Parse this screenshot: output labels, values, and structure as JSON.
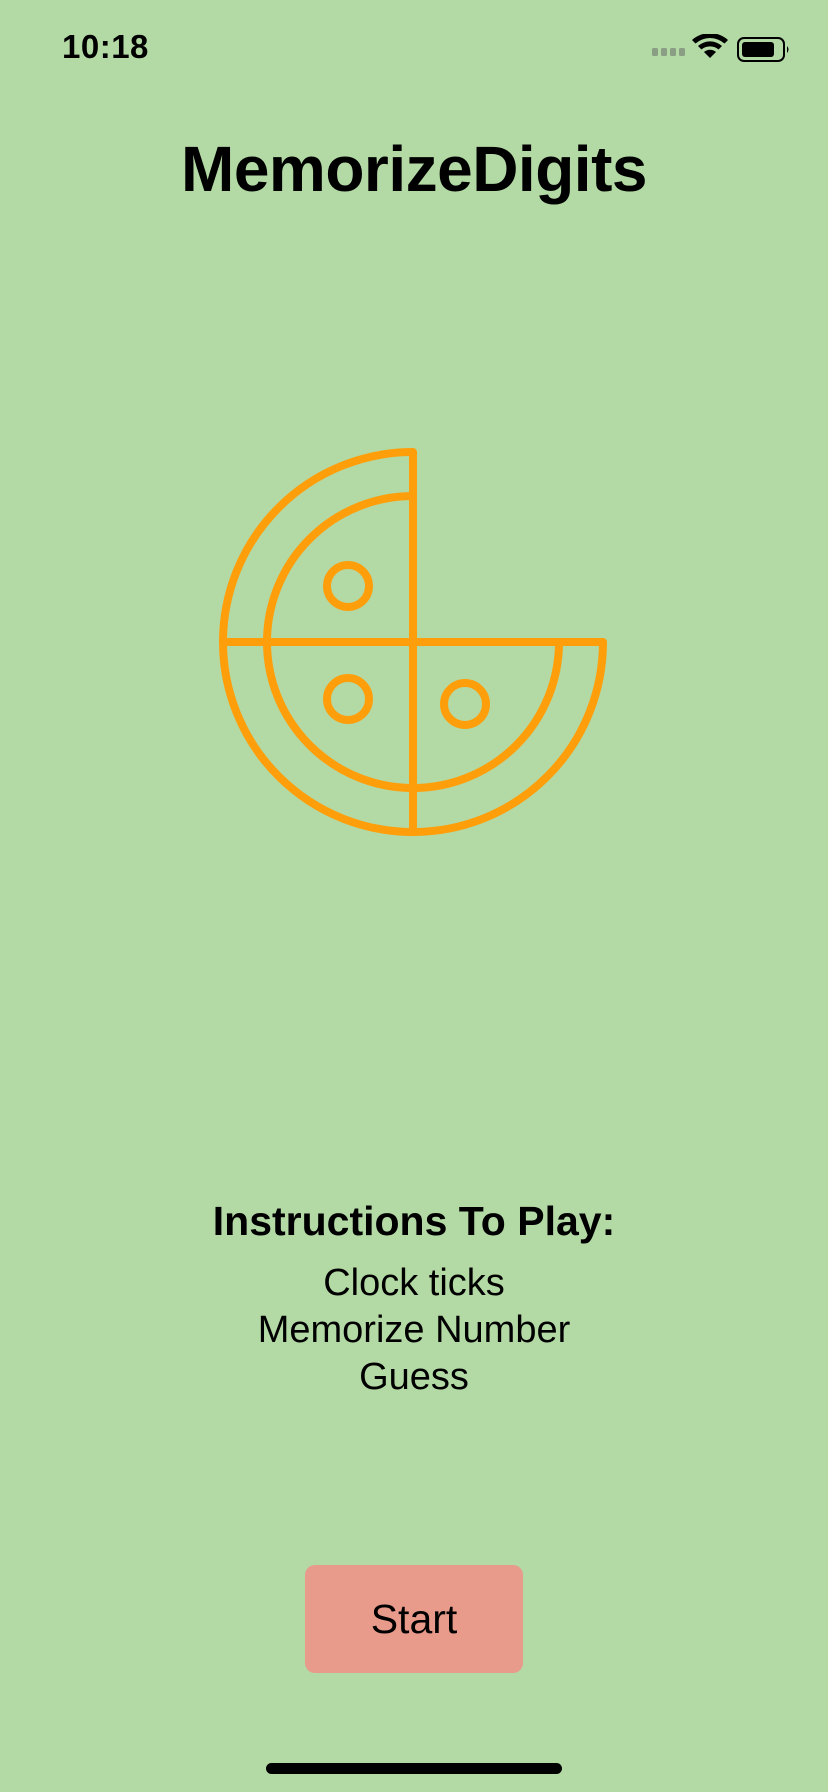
{
  "status_bar": {
    "time": "10:18"
  },
  "app": {
    "title": "MemorizeDigits"
  },
  "logo": {
    "icon": "pizza-icon",
    "color": "#ff9e0b"
  },
  "instructions": {
    "heading": "Instructions To Play:",
    "lines": [
      "Clock ticks",
      "Memorize Number",
      "Guess"
    ]
  },
  "start_button": {
    "label": "Start",
    "color": "#e89a8b"
  },
  "colors": {
    "background": "#b3daa5"
  }
}
